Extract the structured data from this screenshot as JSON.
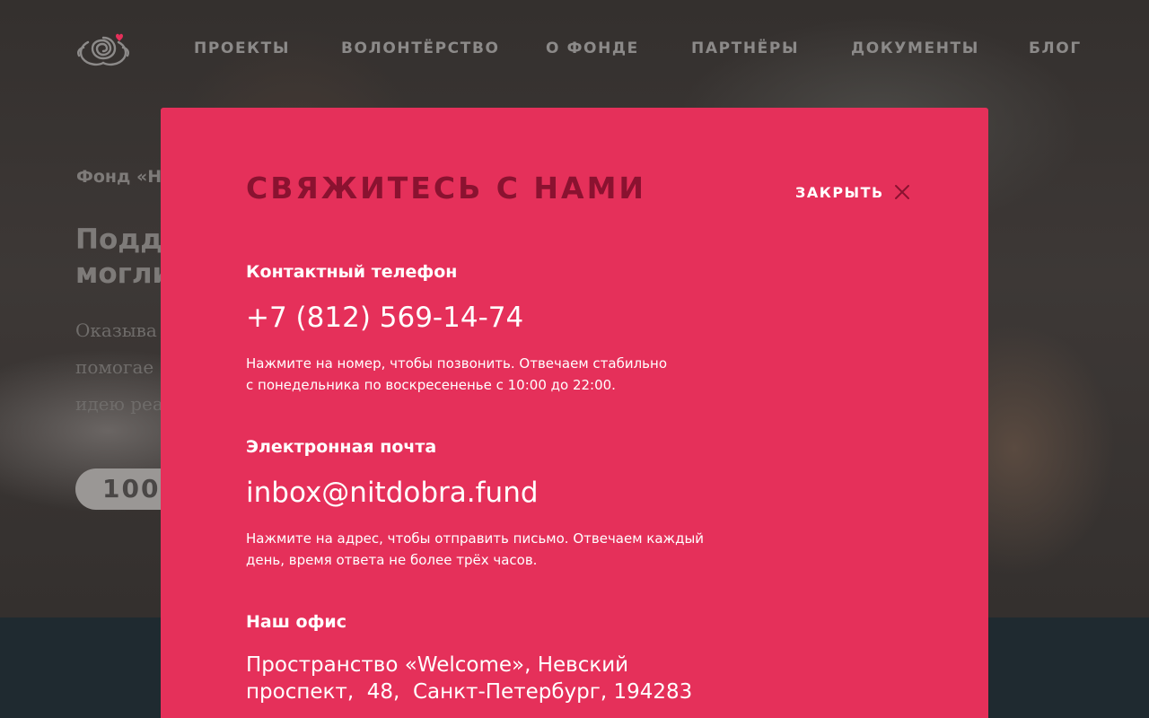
{
  "nav": {
    "logo_icon": "spiral-heart-logo-icon",
    "items": [
      {
        "label": "ПРОЕКТЫ"
      },
      {
        "label": "ВОЛОНТЁРСТВО"
      },
      {
        "label": "О ФОНДЕ"
      },
      {
        "label": "ПАРТНЁРЫ"
      },
      {
        "label": "ДОКУМЕНТЫ"
      },
      {
        "label": "БЛОГ"
      }
    ]
  },
  "hero": {
    "kicker": "Фонд «Н",
    "title": "Подд\nмогли",
    "text": "Оказыва\nпомогае\nидею реа",
    "pill": "100"
  },
  "modal": {
    "title": "СВЯЖИТЕСЬ С НАМИ",
    "close_label": "ЗАКРЫТЬ",
    "close_icon": "close-icon",
    "phone": {
      "label": "Контактный телефон",
      "value": "+7 (812) 569-14-74",
      "note": "Нажмите на номер, чтобы позвонить. Отвечаем стабильно\nс понедельника по воскресененье с 10:00 до 22:00."
    },
    "email": {
      "label": "Электронная почта",
      "value": "inbox@nitdobra.fund",
      "note": "Нажмите на адрес, чтобы отправить письмо. Отвечаем каждый\nдень, время ответа не более трёх часов."
    },
    "office": {
      "label": "Наш офис",
      "address": "Пространство «Welcome», Невский\nпроспект,  48,  Санкт-Петербург, 194283"
    }
  },
  "colors": {
    "modal_bg": "#e5305a",
    "modal_title": "#8a1230",
    "logo_heart": "#e5305a",
    "footer_bg": "#1f2a30"
  }
}
